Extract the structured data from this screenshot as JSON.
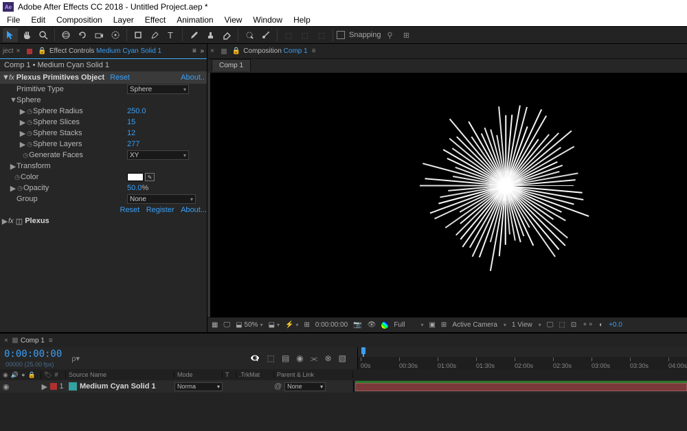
{
  "titlebar": {
    "app": "Adobe After Effects CC 2018 - Untitled Project.aep *",
    "logo": "Ae"
  },
  "menubar": [
    "File",
    "Edit",
    "Composition",
    "Layer",
    "Effect",
    "Animation",
    "View",
    "Window",
    "Help"
  ],
  "toolbar": {
    "snapping": "Snapping"
  },
  "effects_panel": {
    "tab_prefix": "ject",
    "tab_label": "Effect Controls",
    "tab_layer": "Medium Cyan Solid 1",
    "crumb": "Comp 1 • Medium Cyan Solid 1",
    "effect1": {
      "name": "Plexus Primitives Object",
      "reset": "Reset",
      "about": "About..",
      "primitive_type_label": "Primitive Type",
      "primitive_type_value": "Sphere",
      "group": "Sphere",
      "sphere_radius_label": "Sphere Radius",
      "sphere_radius_value": "250.0",
      "sphere_slices_label": "Sphere Slices",
      "sphere_slices_value": "15",
      "sphere_stacks_label": "Sphere Stacks",
      "sphere_stacks_value": "12",
      "sphere_layers_label": "Sphere Layers",
      "sphere_layers_value": "277",
      "generate_faces_label": "Generate Faces",
      "generate_faces_value": "XY",
      "transform_label": "Transform",
      "color_label": "Color",
      "opacity_label": "Opacity",
      "opacity_value": "50.0",
      "opacity_unit": "%",
      "group_label": "Group",
      "group_value": "None",
      "reset2": "Reset",
      "register": "Register",
      "about2": "About..."
    },
    "effect2": {
      "name": "Plexus"
    }
  },
  "comp_panel": {
    "tab_label": "Composition",
    "tab_link": "Comp 1",
    "inner_tab": "Comp 1",
    "footer": {
      "zoom": "50%",
      "timecode": "0:00:00:00",
      "resolution": "Full",
      "camera": "Active Camera",
      "views": "1 View",
      "exposure": "+0.0"
    }
  },
  "timeline": {
    "tab": "Comp 1",
    "timecode": "0:00:00:00",
    "fps": "00000 (25.00 fps)",
    "search_placeholder": "ρ▾",
    "columns": {
      "source": "Source Name",
      "mode": "Mode",
      "t": "T",
      "trkmat": ".TrkMat",
      "parent": "Parent & Link"
    },
    "ticks": [
      "00s",
      "00:30s",
      "01:00s",
      "01:30s",
      "02:00s",
      "02:30s",
      "03:00s",
      "03:30s",
      "04:00s"
    ],
    "layer": {
      "index": "1",
      "name": "Medium Cyan Solid 1",
      "mode": "Norma",
      "parent": "None"
    }
  }
}
